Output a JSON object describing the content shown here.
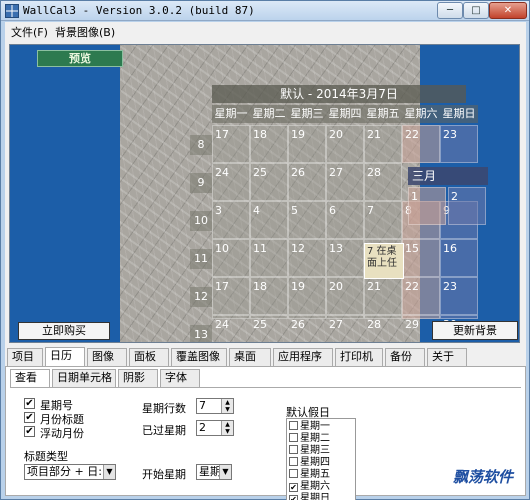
{
  "window": {
    "title": "WallCal3 - Version 3.0.2 (build 87)",
    "buttons": {
      "minimize": "─",
      "maximize": "□",
      "close": "✕"
    }
  },
  "menu": {
    "items": [
      "文件(F)",
      "背景图像(B)"
    ]
  },
  "preview": {
    "label": "预览",
    "calendar_title": "默认 - 2014年3月7日",
    "weekdays": [
      "星期一",
      "星期二",
      "星期三",
      "星期四",
      "星期五",
      "星期六",
      "星期日"
    ],
    "week_numbers": [
      "8",
      "9",
      "10",
      "11",
      "12",
      "13"
    ],
    "rows": [
      [
        "17",
        "18",
        "19",
        "20",
        "21",
        "22",
        "23"
      ],
      [
        "24",
        "25",
        "26",
        "27",
        "28",
        "",
        ""
      ],
      [
        "3",
        "4",
        "5",
        "6",
        "7",
        "8",
        "9"
      ],
      [
        "10",
        "11",
        "12",
        "13",
        "14",
        "15",
        "16"
      ],
      [
        "17",
        "18",
        "19",
        "20",
        "21",
        "22",
        "23"
      ],
      [
        "24",
        "25",
        "26",
        "27",
        "28",
        "29",
        "30"
      ]
    ],
    "march_title": "三月",
    "march_first": [
      "1",
      "2"
    ],
    "today_note": "7 在桌面上任",
    "buy_button": "立即购买",
    "update_button": "更新背景"
  },
  "tabs": [
    "项目",
    "日历",
    "图像",
    "面板",
    "覆盖图像",
    "桌面",
    "应用程序",
    "打印机",
    "备份",
    "关于"
  ],
  "active_tab": "日历",
  "subtabs": [
    "查看",
    "日期单元格",
    "阴影",
    "字体"
  ],
  "active_subtab": "查看",
  "view": {
    "checkboxes": [
      {
        "label": "星期号",
        "checked": true
      },
      {
        "label": "月份标题",
        "checked": true
      },
      {
        "label": "浮动月份",
        "checked": true
      }
    ],
    "title_type_label": "标题类型",
    "title_type_value": "项目部分 + 日:",
    "week_rows_label": "星期行数",
    "week_rows_value": "7",
    "past_weeks_label": "已过星期",
    "past_weeks_value": "2",
    "start_week_label": "开始星期",
    "start_week_value": "星期",
    "holidays_label": "默认假日",
    "holidays": [
      {
        "label": "星期一",
        "checked": false
      },
      {
        "label": "星期二",
        "checked": false
      },
      {
        "label": "星期三",
        "checked": false
      },
      {
        "label": "星期四",
        "checked": false
      },
      {
        "label": "星期五",
        "checked": false
      },
      {
        "label": "星期六",
        "checked": true
      },
      {
        "label": "星期日",
        "checked": true
      }
    ]
  },
  "watermark": "飘荡软件",
  "colors": {
    "preview_bg": "#1c5ea8",
    "accent": "#2d7a4f"
  }
}
